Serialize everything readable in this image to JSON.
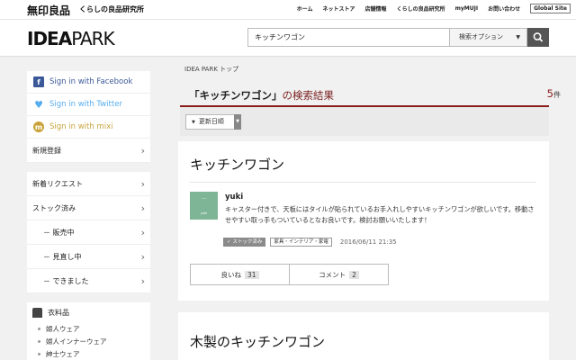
{
  "topbar": {
    "brand": "無印良品",
    "brand_sub": "くらしの良品研究所",
    "nav": [
      "ホーム",
      "ネットストア",
      "店舗情報",
      "くらしの良品研究所",
      "myMUJI",
      "お問い合わせ"
    ],
    "global_site": "Global Site"
  },
  "header": {
    "logo_bold": "IDEA",
    "logo_light": "PARK",
    "search_value": "キッチンワゴン",
    "search_option": "検索オプション",
    "search_option_caret": "▼",
    "search_icon": "search-icon"
  },
  "sidebar": {
    "facebook": "Sign in with Facebook",
    "twitter": "Sign in with Twitter",
    "mixi": "Sign in with mixi",
    "register": "新規登録",
    "new_requests": "新着リクエスト",
    "stocked": "ストック済み",
    "stock_sub": [
      "－ 販売中",
      "－ 見直し中",
      "－ できました"
    ],
    "category": "衣料品",
    "category_items": [
      "婦人ウェア",
      "婦人インナーウェア",
      "紳士ウェア"
    ],
    "chevron": "›",
    "colors": {
      "facebook": "#3b5998",
      "twitter": "#55acee",
      "mixi": "#c9a33a"
    }
  },
  "main": {
    "breadcrumb": "IDEA PARK トップ",
    "result_query": "「キッチンワゴン」",
    "result_suffix": "の検索結果",
    "result_count": "5",
    "result_unit": "件",
    "sort_label": "更新日順",
    "sort_caret": "▼",
    "cards": [
      {
        "title": "キッチンワゴン",
        "user": "yuki",
        "avatar_text": "yuki",
        "body": "キャスター付きで、天板にはタイルが貼られているお手入れしやすいキッチンワゴンが欲しいです。移動させやすい取っ手もついているとなお良いです。検討お願いいたします！",
        "tag_stock": "✓ ストック済み",
        "tag_category": "家具・インテリア・家電",
        "datetime": "2016/06/11 21:35",
        "like_label": "良いね",
        "like_count": "31",
        "comment_label": "コメント",
        "comment_count": "2"
      },
      {
        "title": "木製のキッチンワゴン"
      }
    ],
    "accent_color": "#8b1c1c"
  }
}
